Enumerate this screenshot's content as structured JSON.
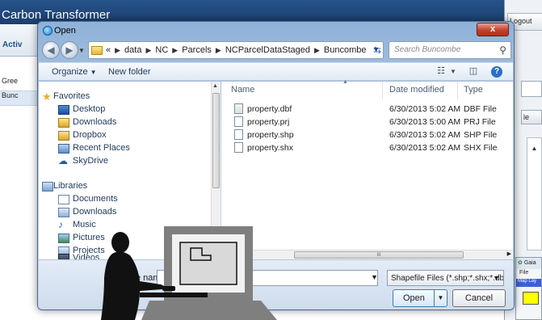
{
  "background_app": {
    "title": "Carbon Transformer",
    "sub_label": "Activ",
    "list_items": [
      "Gree",
      "Bunc"
    ],
    "logout_label": "Logout",
    "right_button_label": "le",
    "gaia_title": "Gaia",
    "gaia_file_label": "File",
    "gaia_layer_label": "Map Lay"
  },
  "dialog": {
    "title": "Open",
    "close_glyph": "x",
    "breadcrumb": [
      "«",
      "data",
      "NC",
      "Parcels",
      "NCParcelDataStaged",
      "Buncombe"
    ],
    "search_placeholder": "Search Buncombe",
    "toolbar": {
      "organize_label": "Organize",
      "new_folder_label": "New folder"
    },
    "nav": {
      "favorites_label": "Favorites",
      "favorites": [
        "Desktop",
        "Downloads",
        "Dropbox",
        "Recent Places",
        "SkyDrive"
      ],
      "libraries_label": "Libraries",
      "libraries": [
        "Documents",
        "Downloads",
        "Music",
        "Pictures",
        "Projects",
        "Videos"
      ]
    },
    "columns": {
      "name": "Name",
      "date_modified": "Date modified",
      "type": "Type"
    },
    "files": [
      {
        "name": "property.dbf",
        "date": "6/30/2013 5:02 AM",
        "type": "DBF File",
        "icon": "dbf-file-icon"
      },
      {
        "name": "property.prj",
        "date": "6/30/2013 5:00 AM",
        "type": "PRJ File",
        "icon": "prj-file-icon"
      },
      {
        "name": "property.shp",
        "date": "6/30/2013 5:02 AM",
        "type": "SHP File",
        "icon": "shp-file-icon"
      },
      {
        "name": "property.shx",
        "date": "6/30/2013 5:02 AM",
        "type": "SHX File",
        "icon": "shx-file-icon"
      }
    ],
    "scroll_grip": "III",
    "file_name_label": "e name:",
    "file_name_value": "",
    "file_type_selected": "Shapefile Files (*.shp;*.shx;*.dbf",
    "open_label": "Open",
    "cancel_label": "Cancel"
  },
  "colors": {
    "titlebar": "#1b3f6e",
    "dialog_frame": "#b9cfe8",
    "close_button": "#c3412d",
    "overlay_silhouette": "#111111",
    "overlay_laptop": "#7f7f7f"
  }
}
